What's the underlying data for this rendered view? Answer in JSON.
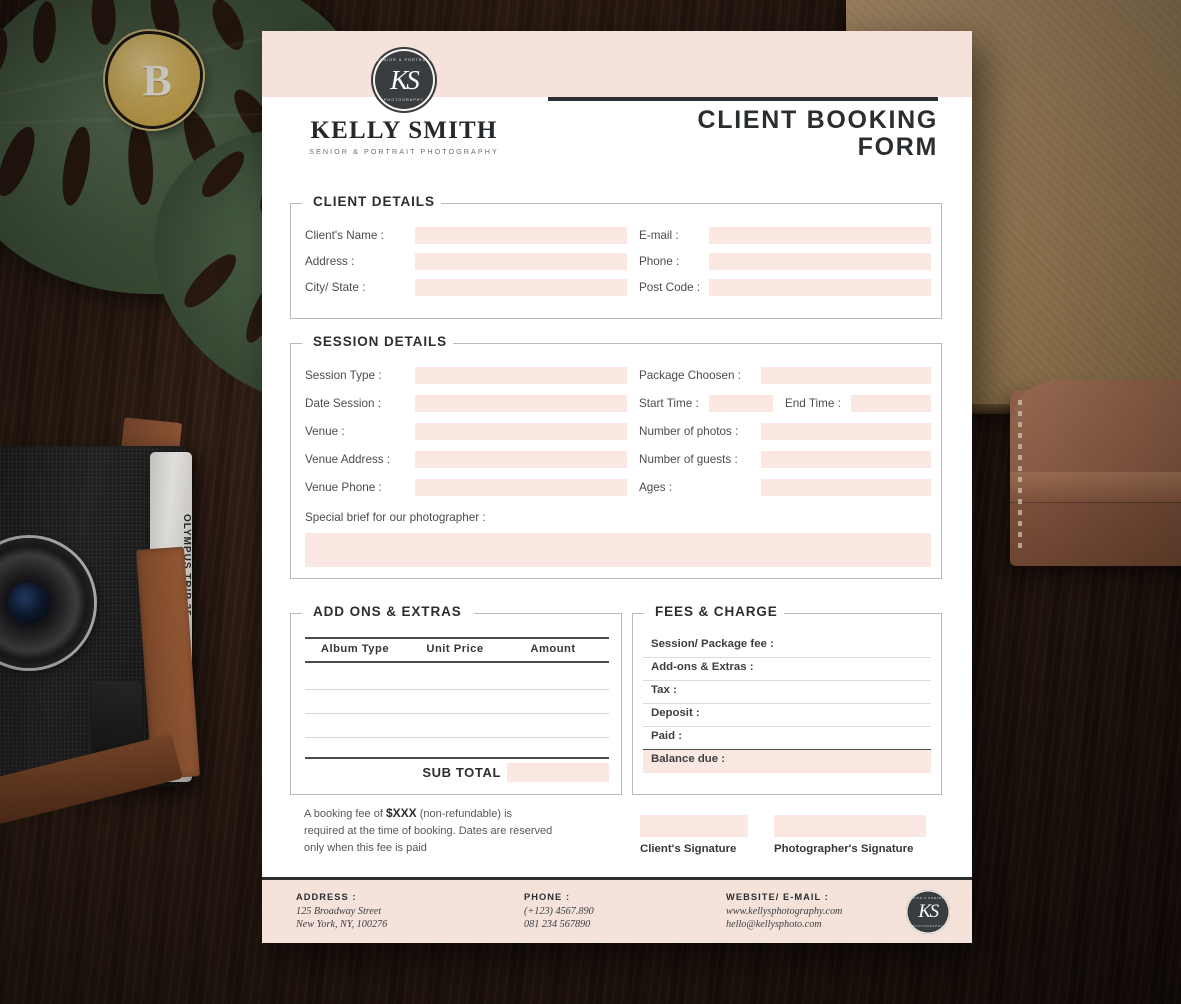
{
  "brand": {
    "logo_monogram": "KS",
    "logo_arc_top": "SENIOR & PORTRAIT",
    "logo_arc_bottom": "PHOTOGRAPHY",
    "name": "KELLY SMITH",
    "tagline": "SENIOR & PORTRAIT PHOTOGRAPHY"
  },
  "document": {
    "title_line1": "CLIENT BOOKING",
    "title_line2": "FORM"
  },
  "client_details": {
    "legend": "CLIENT DETAILS",
    "left_fields": [
      {
        "label": "Client's Name :",
        "value": ""
      },
      {
        "label": "Address :",
        "value": ""
      },
      {
        "label": "City/ State :",
        "value": ""
      }
    ],
    "right_fields": [
      {
        "label": "E-mail :",
        "value": ""
      },
      {
        "label": "Phone :",
        "value": ""
      },
      {
        "label": "Post Code :",
        "value": ""
      }
    ]
  },
  "session_details": {
    "legend": "SESSION DETAILS",
    "left_fields": [
      {
        "label": "Session Type :",
        "value": ""
      },
      {
        "label": "Date Session :",
        "value": ""
      },
      {
        "label": "Venue :",
        "value": ""
      },
      {
        "label": "Venue Address :",
        "value": ""
      },
      {
        "label": "Venue Phone :",
        "value": ""
      }
    ],
    "right_fields": [
      {
        "label": "Package Choosen :",
        "value": ""
      },
      {
        "label": "Number of photos :",
        "value": ""
      },
      {
        "label": "Number of guests :",
        "value": ""
      },
      {
        "label": "Ages :",
        "value": ""
      }
    ],
    "time_row": {
      "start_label": "Start Time :",
      "start_value": "",
      "end_label": "End Time :",
      "end_value": ""
    },
    "brief_label": "Special brief for our photographer :",
    "brief_value": ""
  },
  "add_ons": {
    "legend": "ADD ONS & EXTRAS",
    "columns": [
      "Album Type",
      "Unit Price",
      "Amount"
    ],
    "rows": [
      [
        "",
        "",
        ""
      ],
      [
        "",
        "",
        ""
      ],
      [
        "",
        "",
        ""
      ]
    ],
    "subtotal_label": "SUB TOTAL",
    "subtotal_value": ""
  },
  "fees": {
    "legend": "FEES & CHARGE",
    "rows": [
      {
        "label": "Session/ Package fee :",
        "value": "",
        "highlight": false
      },
      {
        "label": "Add-ons & Extras :",
        "value": "",
        "highlight": false
      },
      {
        "label": "Tax :",
        "value": "",
        "highlight": false
      },
      {
        "label": "Deposit :",
        "value": "",
        "highlight": false
      },
      {
        "label": "Paid :",
        "value": "",
        "highlight": false
      },
      {
        "label": "Balance due :",
        "value": "",
        "highlight": true
      }
    ]
  },
  "booking_note": {
    "text_before": "A booking fee of ",
    "amount": "$XXX",
    "text_after": " (non-refundable) is required at the time of booking. Dates are reserved only when this fee is paid"
  },
  "signatures": [
    {
      "label": "Client's Signature",
      "value": ""
    },
    {
      "label": "Photographer's Signature",
      "value": ""
    }
  ],
  "footer": {
    "address": {
      "heading": "ADDRESS :",
      "line1": "125 Broadway Street",
      "line2": "New York, NY, 100276"
    },
    "phone": {
      "heading": "PHONE :",
      "line1": "(+123) 4567.890",
      "line2": "081 234 567890"
    },
    "web": {
      "heading": "WEBSITE/ E-MAIL :",
      "line1": "www.kellysphotography.com",
      "line2": "hello@kellysphoto.com"
    },
    "logo_monogram": "KS",
    "logo_arc_top": "SENIOR & PORTRAIT",
    "logo_arc_bottom": "PHOTOGRAPHY"
  },
  "scene": {
    "camera_brand": "OLYMPUS TRIP 35",
    "badge_monogram": "B"
  },
  "colors": {
    "paper": "#ffffff",
    "band_pink": "#f4e2db",
    "field_pink": "#fbe8e2",
    "ink": "#2b2e30",
    "label": "#4a4d50",
    "rule": "#b9b9b9"
  }
}
